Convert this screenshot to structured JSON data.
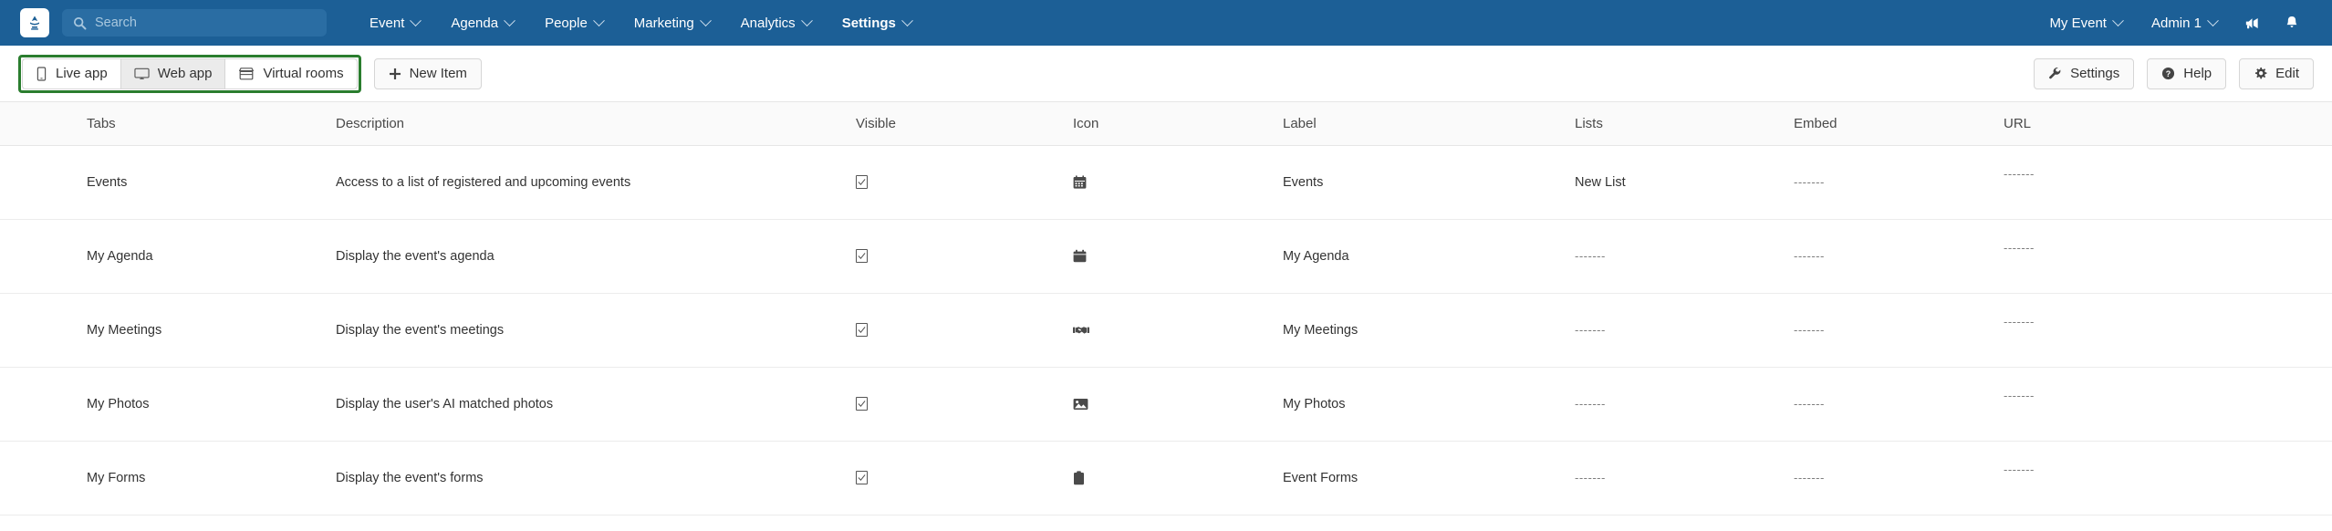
{
  "nav": {
    "logo_icon": "app-logo-icon",
    "search": {
      "value": "",
      "placeholder": "Search",
      "icon": "search-icon"
    },
    "items": [
      {
        "label": "Event",
        "active": false
      },
      {
        "label": "Agenda",
        "active": false
      },
      {
        "label": "People",
        "active": false
      },
      {
        "label": "Marketing",
        "active": false
      },
      {
        "label": "Analytics",
        "active": false
      },
      {
        "label": "Settings",
        "active": true
      }
    ],
    "right": {
      "event_selector": "My Event",
      "user_menu": "Admin 1",
      "announcement_icon": "megaphone-icon",
      "notification_icon": "bell-icon"
    }
  },
  "toolbar": {
    "highlight_color": "#2a7d2e",
    "apps": [
      {
        "label": "Live app",
        "icon": "mobile-phone-icon",
        "selected": false
      },
      {
        "label": "Web app",
        "icon": "desktop-monitor-icon",
        "selected": true
      },
      {
        "label": "Virtual rooms",
        "icon": "store-awning-icon",
        "selected": false
      }
    ],
    "new_item": {
      "label": "New Item",
      "icon": "plus-icon"
    },
    "right_buttons": [
      {
        "label": "Settings",
        "icon": "wrench-icon"
      },
      {
        "label": "Help",
        "icon": "question-circle-icon"
      },
      {
        "label": "Edit",
        "icon": "gear-icon"
      }
    ]
  },
  "table": {
    "headers": [
      "Tabs",
      "Description",
      "Visible",
      "Icon",
      "Label",
      "Lists",
      "Embed",
      "URL"
    ],
    "rows": [
      {
        "tabs": "Events",
        "description": "Access to a list of registered and upcoming events",
        "visible": true,
        "icon": "calendar-grid-icon",
        "label": "Events",
        "lists": "New List",
        "embed": "-------",
        "url": "-------"
      },
      {
        "tabs": "My Agenda",
        "description": "Display the event's agenda",
        "visible": true,
        "icon": "calendar-solid-icon",
        "label": "My Agenda",
        "lists": "-------",
        "embed": "-------",
        "url": "-------"
      },
      {
        "tabs": "My Meetings",
        "description": "Display the event's meetings",
        "visible": true,
        "icon": "handshake-icon",
        "label": "My Meetings",
        "lists": "-------",
        "embed": "-------",
        "url": "-------"
      },
      {
        "tabs": "My Photos",
        "description": "Display the user's AI matched photos",
        "visible": true,
        "icon": "photo-image-icon",
        "label": "My Photos",
        "lists": "-------",
        "embed": "-------",
        "url": "-------"
      },
      {
        "tabs": "My Forms",
        "description": "Display the event's forms",
        "visible": true,
        "icon": "clipboard-icon",
        "label": "Event Forms",
        "lists": "-------",
        "embed": "-------",
        "url": "-------"
      }
    ]
  }
}
